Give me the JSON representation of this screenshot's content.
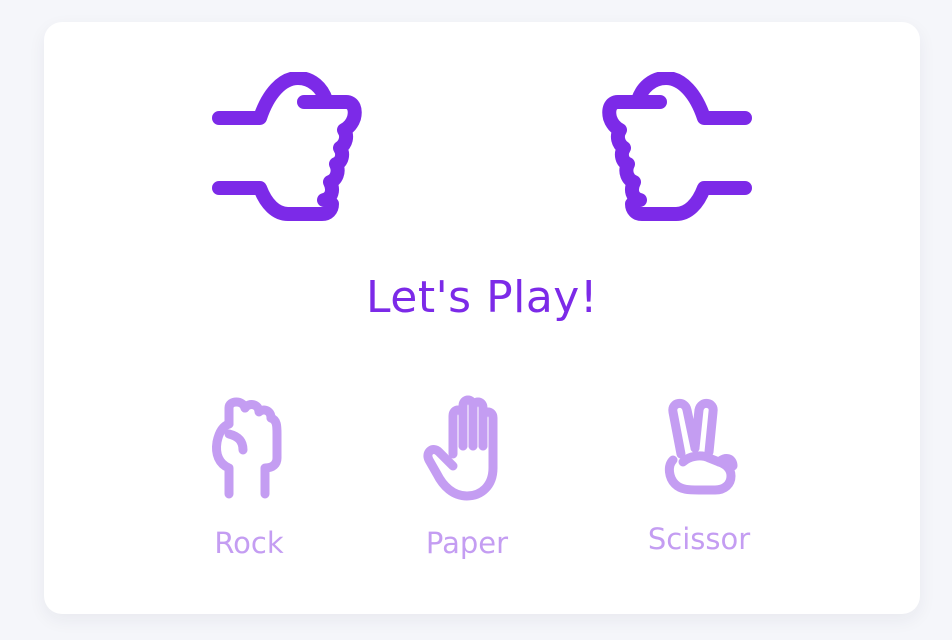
{
  "game": {
    "title": "Let's Play!",
    "player_hand_icon": "rock-fist-icon",
    "computer_hand_icon": "rock-fist-icon",
    "choices": [
      {
        "label": "Rock",
        "icon": "rock-icon"
      },
      {
        "label": "Paper",
        "icon": "paper-icon"
      },
      {
        "label": "Scissor",
        "icon": "scissor-icon"
      }
    ]
  },
  "colors": {
    "accent": "#7c2ae8",
    "accent_light": "#c49df2",
    "card_bg": "#ffffff",
    "page_bg": "#f5f6fa"
  }
}
